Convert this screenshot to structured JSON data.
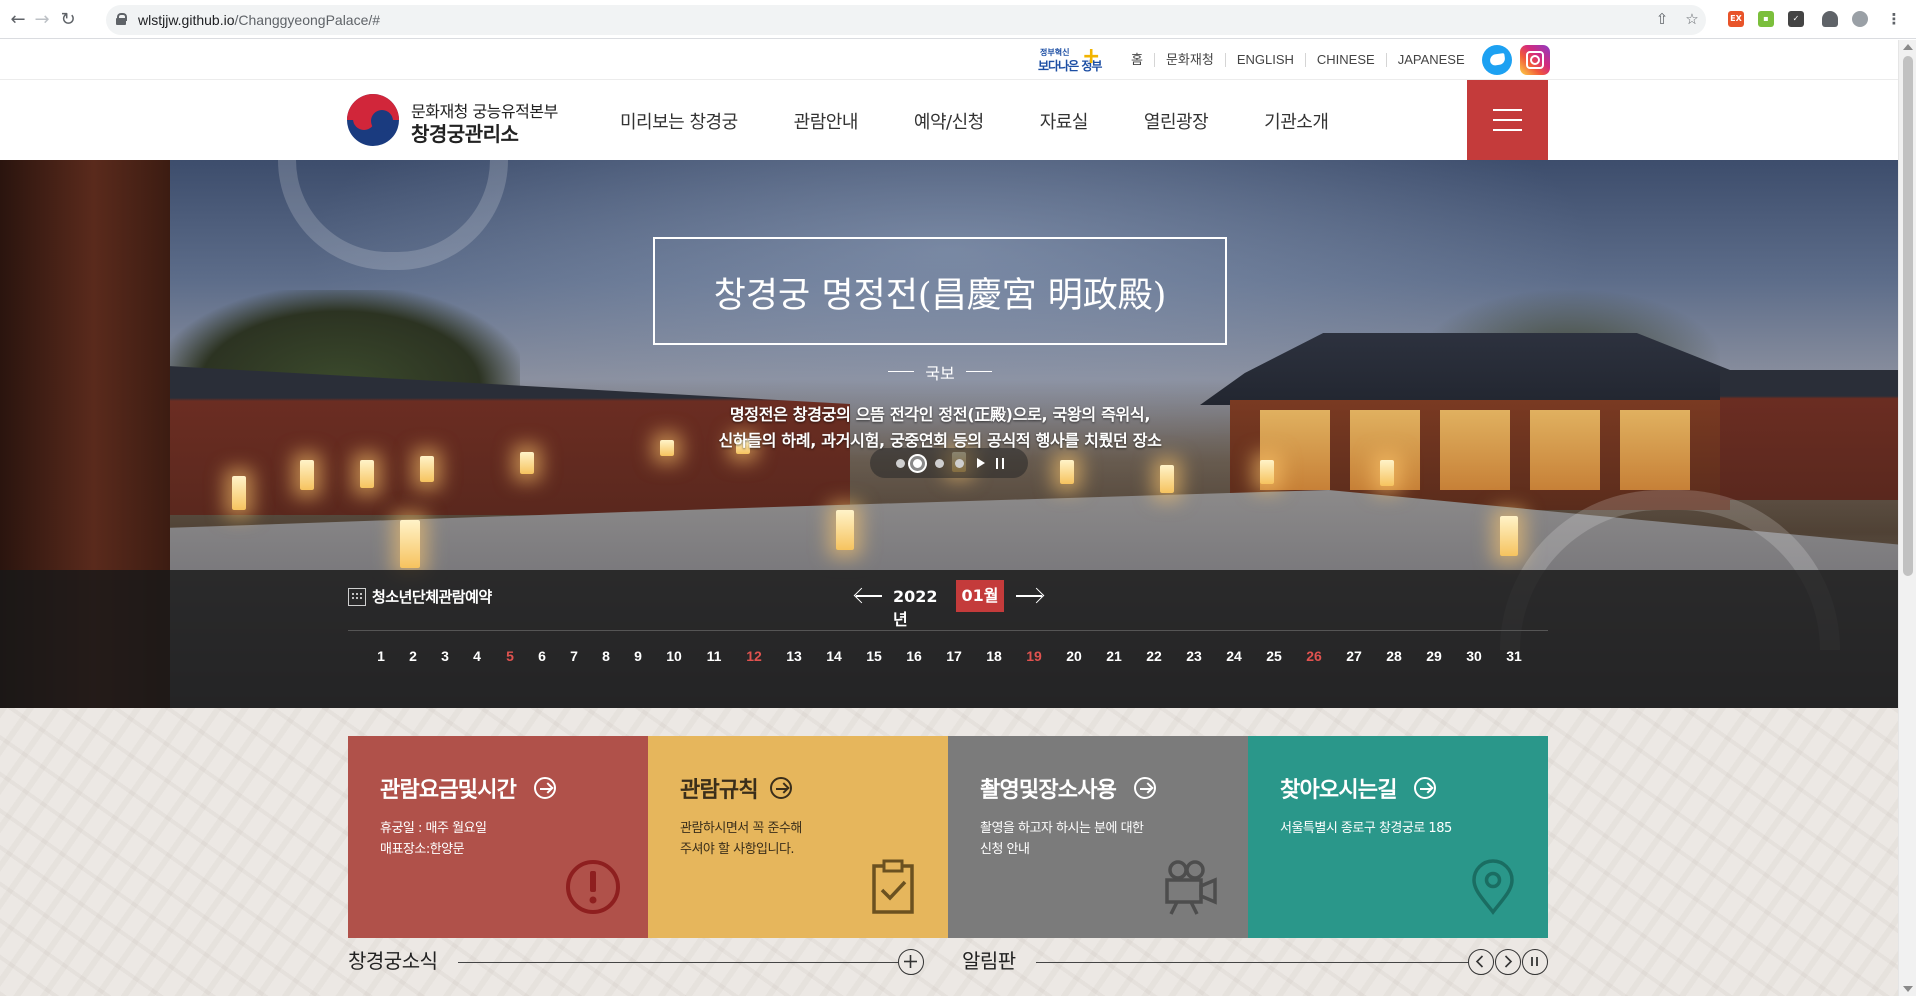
{
  "browser": {
    "url_host": "wlstjjw.github.io",
    "url_path": "/ChanggyeongPalace/#"
  },
  "util": {
    "gov_small": "정부혁신",
    "gov_big": "보다나은 정부",
    "links": [
      "홈",
      "문화재청",
      "ENGLISH",
      "CHINESE",
      "JAPANESE"
    ]
  },
  "header": {
    "brand_sub": "문화재청 궁능유적본부",
    "brand_main": "창경궁관리소",
    "nav": [
      "미리보는 창경궁",
      "관람안내",
      "예약/신청",
      "자료실",
      "열린광장",
      "기관소개"
    ]
  },
  "hero": {
    "title": "창경궁 명정전(昌慶宮 明政殿)",
    "tag": "국보",
    "desc_line1": "명정전은 창경궁의 으뜸 전각인 정전(正殿)으로, 국왕의 즉위식,",
    "desc_line2": "신하들의 하례, 과거시험, 궁중연회 등의 공식적 행사를 치뤘던 장소",
    "slide_count": 4,
    "active_slide": 2
  },
  "calendar": {
    "label": "청소년단체관람예약",
    "year": "2022년",
    "month": "01월",
    "days": [
      "1",
      "2",
      "3",
      "4",
      "5",
      "6",
      "7",
      "8",
      "9",
      "10",
      "11",
      "12",
      "13",
      "14",
      "15",
      "16",
      "17",
      "18",
      "19",
      "20",
      "21",
      "22",
      "23",
      "24",
      "25",
      "26",
      "27",
      "28",
      "29",
      "30",
      "31"
    ],
    "sundays": [
      "5",
      "12",
      "19",
      "26"
    ]
  },
  "cards": [
    {
      "title": "관람요금및시간",
      "line1": "휴궁일 : 매주 월요일",
      "line2": "매표장소:한양문",
      "icon": "alert-circle-icon"
    },
    {
      "title": "관람규칙",
      "line1": "관람하시면서 꼭 준수해",
      "line2": "주셔야 할 사항입니다.",
      "icon": "clipboard-check-icon"
    },
    {
      "title": "촬영및장소사용",
      "line1": "촬영을 하고자 하시는 분에 대한",
      "line2": "신청 안내",
      "icon": "video-camera-icon"
    },
    {
      "title": "찾아오시는길",
      "line1": "서울특별시 종로구 창경궁로 185",
      "line2": "",
      "icon": "map-pin-icon"
    }
  ],
  "sections": {
    "news": "창경궁소식",
    "board": "알림판"
  },
  "colors": {
    "accent_red": "#c43b3b",
    "card1": "#b0514a",
    "card2": "#e6b65c",
    "card3": "#7b7b7b",
    "card4": "#2a978a"
  }
}
